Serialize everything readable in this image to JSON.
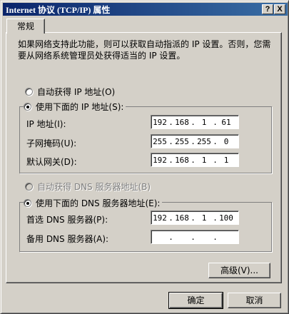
{
  "window": {
    "title": "Internet 协议 (TCP/IP) 属性",
    "help_label": "?",
    "close_label": "X"
  },
  "tab": {
    "label": "常规"
  },
  "description": "如果网络支持此功能，则可以获取自动指派的 IP 设置。否则，您需要从网络系统管理员处获得适当的 IP 设置。",
  "ip": {
    "auto_label": "自动获得 IP 地址(O)",
    "manual_label": "使用下面的 IP 地址(S):",
    "address_label": "IP 地址(I):",
    "address": [
      "192",
      "168",
      "1",
      "61"
    ],
    "mask_label": "子网掩码(U):",
    "mask": [
      "255",
      "255",
      "255",
      "0"
    ],
    "gateway_label": "默认网关(D):",
    "gateway": [
      "192",
      "168",
      "1",
      "1"
    ]
  },
  "dns": {
    "auto_label": "自动获得 DNS 服务器地址(B)",
    "manual_label": "使用下面的 DNS 服务器地址(E):",
    "preferred_label": "首选 DNS 服务器(P):",
    "preferred": [
      "192",
      "168",
      "1",
      "100"
    ],
    "alternate_label": "备用 DNS 服务器(A):",
    "alternate": [
      "",
      "",
      "",
      ""
    ]
  },
  "buttons": {
    "advanced": "高级(V)...",
    "ok": "确定",
    "cancel": "取消"
  }
}
